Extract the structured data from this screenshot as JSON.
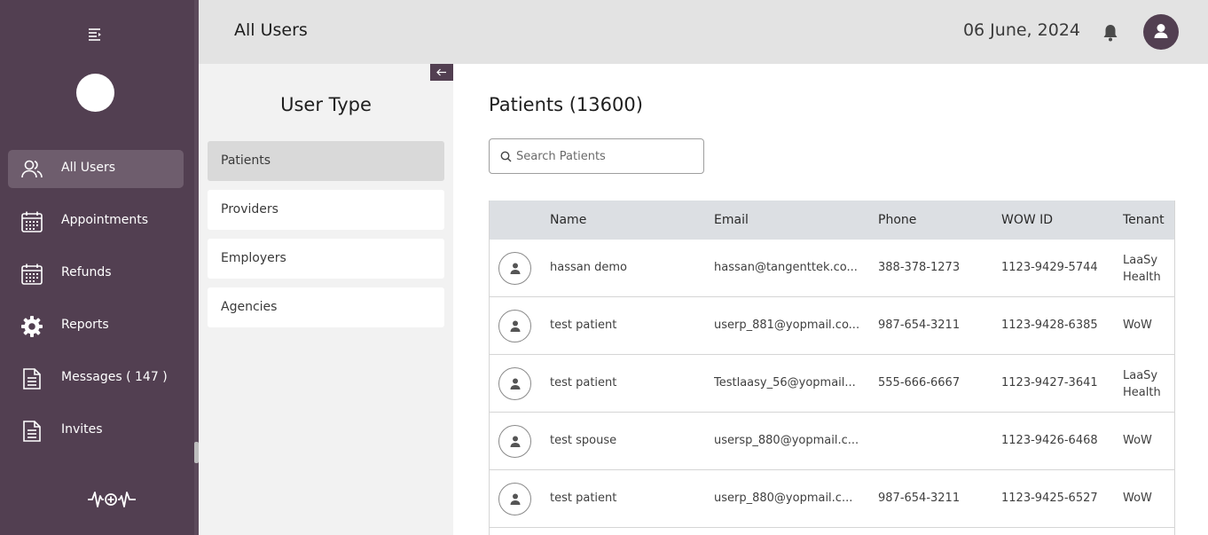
{
  "sidebar": {
    "items": [
      {
        "label": "All Users",
        "icon": "users-icon",
        "active": true
      },
      {
        "label": "Appointments",
        "icon": "calendar-icon",
        "active": false
      },
      {
        "label": "Refunds",
        "icon": "calendar-icon",
        "active": false
      },
      {
        "label": "Reports",
        "icon": "gear-icon",
        "active": false
      },
      {
        "label": "Messages ( 147 )",
        "icon": "document-icon",
        "active": false
      },
      {
        "label": "Invites",
        "icon": "document-icon",
        "active": false
      }
    ]
  },
  "header": {
    "title": "All Users",
    "date": "06 June, 2024"
  },
  "user_type": {
    "title": "User Type",
    "items": [
      {
        "label": "Patients",
        "active": true
      },
      {
        "label": "Providers",
        "active": false
      },
      {
        "label": "Employers",
        "active": false
      },
      {
        "label": "Agencies",
        "active": false
      }
    ]
  },
  "main": {
    "title": "Patients (13600)",
    "search_placeholder": "Search Patients",
    "columns": [
      "Name",
      "Email",
      "Phone",
      "WOW ID",
      "Tenant"
    ],
    "rows": [
      {
        "name": "hassan demo",
        "email": "hassan@tangenttek.co...",
        "phone": "388-378-1273",
        "wow_id": "1123-9429-5744",
        "tenant": "LaaSy Health"
      },
      {
        "name": "test patient",
        "email": "userp_881@yopmail.co...",
        "phone": "987-654-3211",
        "wow_id": "1123-9428-6385",
        "tenant": "WoW"
      },
      {
        "name": "test patient",
        "email": "Testlaasy_56@yopmail...",
        "phone": "555-666-6667",
        "wow_id": "1123-9427-3641",
        "tenant": "LaaSy Health"
      },
      {
        "name": "test spouse",
        "email": "usersp_880@yopmail.c...",
        "phone": "",
        "wow_id": "1123-9426-6468",
        "tenant": "WoW"
      },
      {
        "name": "test patient",
        "email": "userp_880@yopmail.c...",
        "phone": "987-654-3211",
        "wow_id": "1123-9425-6527",
        "tenant": "WoW"
      }
    ]
  },
  "colors": {
    "sidebar_bg": "#523f51",
    "sidebar_active": "#6e5d6d",
    "header_bg": "#e3e3e3",
    "panel_bg": "#f2f2f2",
    "table_header_bg": "#dcdfe3"
  }
}
